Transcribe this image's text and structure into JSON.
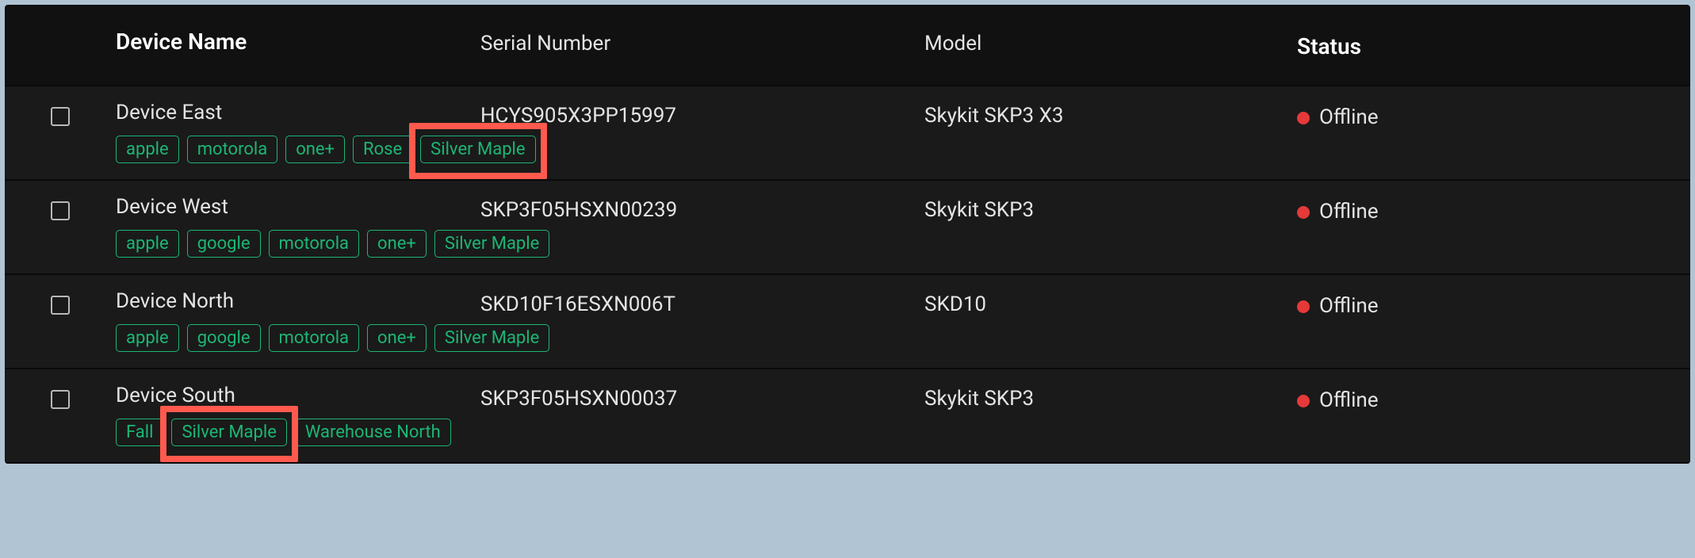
{
  "headers": {
    "name": "Device Name",
    "serial": "Serial Number",
    "model": "Model",
    "status": "Status"
  },
  "rows": [
    {
      "name": "Device East",
      "serial": "HCYS905X3PP15997",
      "model": "Skykit SKP3 X3",
      "status": "Offline",
      "tags": [
        "apple",
        "motorola",
        "one+",
        "Rose",
        "Silver Maple"
      ],
      "highlighted_tag_index": 4
    },
    {
      "name": "Device West",
      "serial": "SKP3F05HSXN00239",
      "model": "Skykit SKP3",
      "status": "Offline",
      "tags": [
        "apple",
        "google",
        "motorola",
        "one+",
        "Silver Maple"
      ],
      "highlighted_tag_index": null
    },
    {
      "name": "Device North",
      "serial": "SKD10F16ESXN006T",
      "model": "SKD10",
      "status": "Offline",
      "tags": [
        "apple",
        "google",
        "motorola",
        "one+",
        "Silver Maple"
      ],
      "highlighted_tag_index": null
    },
    {
      "name": "Device South",
      "serial": "SKP3F05HSXN00037",
      "model": "Skykit SKP3",
      "status": "Offline",
      "tags": [
        "Fall",
        "Silver Maple",
        "Warehouse North"
      ],
      "highlighted_tag_index": 1
    }
  ]
}
